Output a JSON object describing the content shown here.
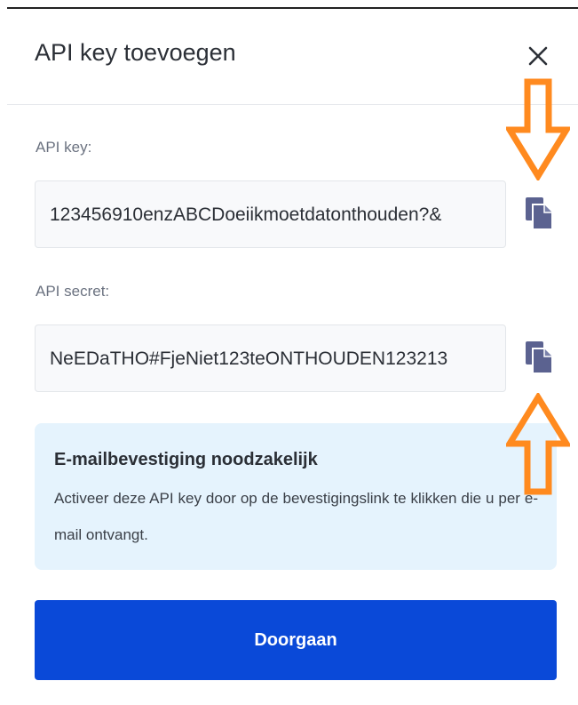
{
  "modal": {
    "title": "API key toevoegen",
    "close_icon": "close-icon"
  },
  "fields": {
    "api_key": {
      "label": "API key:",
      "value": "123456910enzABCDoeiikmoetdatonthouden?&",
      "copy_icon": "copy-icon"
    },
    "api_secret": {
      "label": "API secret:",
      "value": "NeEDaTHO#FjeNiet123teONTHOUDEN123213",
      "copy_icon": "copy-icon"
    }
  },
  "notice": {
    "title": "E-mailbevestiging noodzakelijk",
    "body": "Activeer deze API key door op de bevestigingslink te klikken die u per e-mail ontvangt."
  },
  "actions": {
    "continue_label": "Doorgaan"
  },
  "annotations": {
    "arrow_color": "#ff8a1f",
    "arrows": [
      "arrow-down-icon",
      "arrow-up-icon"
    ]
  },
  "colors": {
    "primary": "#0a49d8",
    "notice_bg": "#e5f3fd",
    "copy_icon": "#5b6290"
  }
}
